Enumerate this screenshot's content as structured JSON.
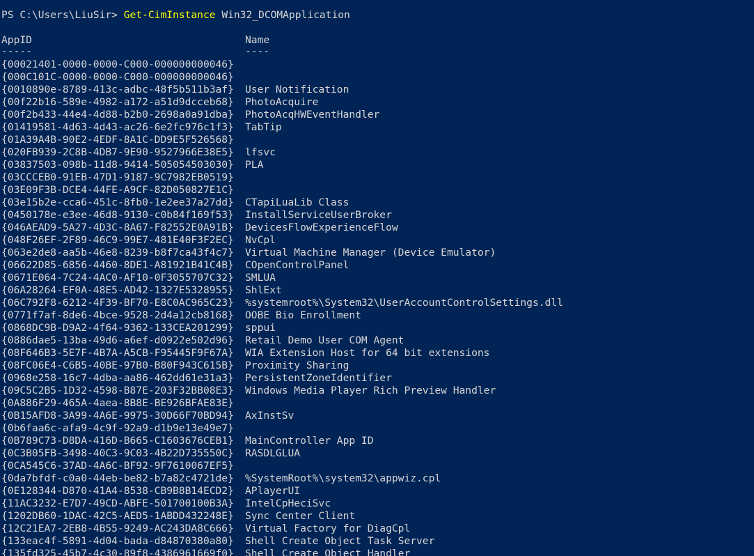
{
  "prompt": {
    "path": "PS C:\\Users\\LiuSir> ",
    "command": "Get-CimInstance",
    "argument": " Win32_DCOMApplication"
  },
  "header": {
    "appid": "AppID",
    "name": "Name",
    "appid_underline": "-----",
    "name_underline": "----"
  },
  "rows": [
    {
      "id": "{00021401-0000-0000-C000-000000000046}",
      "name": ""
    },
    {
      "id": "{000C101C-0000-0000-C000-000000000046}",
      "name": ""
    },
    {
      "id": "{0010890e-8789-413c-adbc-48f5b511b3af}",
      "name": "User Notification"
    },
    {
      "id": "{00f22b16-589e-4982-a172-a51d9dcceb68}",
      "name": "PhotoAcquire"
    },
    {
      "id": "{00f2b433-44e4-4d88-b2b0-2698a0a91dba}",
      "name": "PhotoAcqHWEventHandler"
    },
    {
      "id": "{01419581-4d63-4d43-ac26-6e2fc976c1f3}",
      "name": "TabTip"
    },
    {
      "id": "{01A39A4B-90E2-4EDF-8A1C-DD9E5F526568}",
      "name": ""
    },
    {
      "id": "{020FB939-2C8B-4DB7-9E90-9527966E38E5}",
      "name": "lfsvc"
    },
    {
      "id": "{03837503-098b-11d8-9414-505054503030}",
      "name": "PLA"
    },
    {
      "id": "{03CCCEB0-91EB-47D1-9187-9C7982EB0519}",
      "name": ""
    },
    {
      "id": "{03E09F3B-DCE4-44FE-A9CF-82D050827E1C}",
      "name": ""
    },
    {
      "id": "{03e15b2e-cca6-451c-8fb0-1e2ee37a27dd}",
      "name": "CTapiLuaLib Class"
    },
    {
      "id": "{0450178e-e3ee-46d8-9130-c0b84f169f53}",
      "name": "InstallServiceUserBroker"
    },
    {
      "id": "{046AEAD9-5A27-4D3C-8A67-F82552E0A91B}",
      "name": "DevicesFlowExperienceFlow"
    },
    {
      "id": "{048F26EF-2F89-46C9-99E7-481E40F3F2EC}",
      "name": "NvCpl"
    },
    {
      "id": "{063e2de8-aa5b-46e8-8239-b8f7ca43f4c7}",
      "name": "Virtual Machine Manager (Device Emulator)"
    },
    {
      "id": "{06622D85-6856-4460-8DE1-A81921B41C4B}",
      "name": "COpenControlPanel"
    },
    {
      "id": "{0671E064-7C24-4AC0-AF10-0F3055707C32}",
      "name": "SMLUA"
    },
    {
      "id": "{06A28264-EF0A-48E5-AD42-1327E5328955}",
      "name": "ShlExt"
    },
    {
      "id": "{06C792F8-6212-4F39-BF70-E8C0AC965C23}",
      "name": "%systemroot%\\System32\\UserAccountControlSettings.dll"
    },
    {
      "id": "{0771f7af-8de6-4bce-9528-2d4a12cb8168}",
      "name": "OOBE Bio Enrollment"
    },
    {
      "id": "{0868DC9B-D9A2-4f64-9362-133CEA201299}",
      "name": "sppui"
    },
    {
      "id": "{0886dae5-13ba-49d6-a6ef-d0922e502d96}",
      "name": "Retail Demo User COM Agent"
    },
    {
      "id": "{08F646B3-5E7F-4B7A-A5CB-F95445F9F67A}",
      "name": "WIA Extension Host for 64 bit extensions"
    },
    {
      "id": "{08FC06E4-C6B5-40BE-97B0-B80F943C615B}",
      "name": "Proximity Sharing"
    },
    {
      "id": "{0968e258-16c7-4dba-aa86-462dd61e31a3}",
      "name": "PersistentZoneIdentifier"
    },
    {
      "id": "{09C5C2B5-1D32-4598-B87E-203F32BB08E3}",
      "name": "Windows Media Player Rich Preview Handler"
    },
    {
      "id": "{0A886F29-465A-4aea-8B8E-BE926BFAE83E}",
      "name": ""
    },
    {
      "id": "{0B15AFD8-3A99-4A6E-9975-30D66F70BD94}",
      "name": "AxInstSv"
    },
    {
      "id": "{0b6faa6c-afa9-4c9f-92a9-d1b9e13e49e7}",
      "name": ""
    },
    {
      "id": "{0B789C73-D8DA-416D-B665-C1603676CEB1}",
      "name": "MainController App ID"
    },
    {
      "id": "{0C3B05FB-3498-40C3-9C03-4B22D735550C}",
      "name": "RASDLGLUA"
    },
    {
      "id": "{0CA545C6-37AD-4A6C-BF92-9F7610067EF5}",
      "name": ""
    },
    {
      "id": "{0da7bfdf-c0a0-44eb-be82-b7a82c4721de}",
      "name": "%SystemRoot%\\system32\\appwiz.cpl"
    },
    {
      "id": "{0E128344-D870-41A4-8538-CB9B8B14ECD2}",
      "name": "APlayerUI"
    },
    {
      "id": "{11AC3232-E7D7-49CD-ABFE-501700100B3A}",
      "name": "IntelCpHeciSvc"
    },
    {
      "id": "{1202DB60-1DAC-42C5-AED5-1ABDD432248E}",
      "name": "Sync Center Client"
    },
    {
      "id": "{12C21EA7-2EB8-4B55-9249-AC243DA8C666}",
      "name": "Virtual Factory for DiagCpl"
    },
    {
      "id": "{133eac4f-5891-4d04-bada-d84870380a80}",
      "name": "Shell Create Object Task Server"
    },
    {
      "id": "{135fd325-45b7-4c30-89f8-4386961669f0}",
      "name": "Shell Create Object Handler"
    }
  ],
  "colors": {
    "background": "#012456",
    "text": "#d6d6d6",
    "command": "#ffff00"
  }
}
